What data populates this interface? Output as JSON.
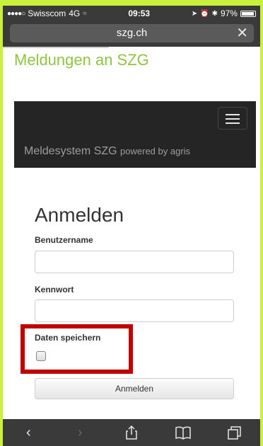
{
  "statusbar": {
    "carrier": "Swisscom",
    "network": "4G",
    "time": "09:53",
    "battery": "97%"
  },
  "browser": {
    "url": "szg.ch",
    "close_icon": "close-icon"
  },
  "page": {
    "title": "Meldungen an SZG",
    "navbar": {
      "brand": "Meldesystem SZG",
      "brand_sub": "powered by agris",
      "menu_icon": "hamburger-menu-icon"
    },
    "login": {
      "heading": "Anmelden",
      "username_label": "Benutzername",
      "username_value": "",
      "password_label": "Kennwort",
      "password_value": "",
      "remember_label": "Daten speichern",
      "remember_checked": false,
      "submit_label": "Anmelden"
    }
  },
  "colors": {
    "frame": "#c8f03c",
    "title_green": "#8ec63f",
    "navbar_bg": "#252525",
    "highlight_red": "#c00000"
  }
}
